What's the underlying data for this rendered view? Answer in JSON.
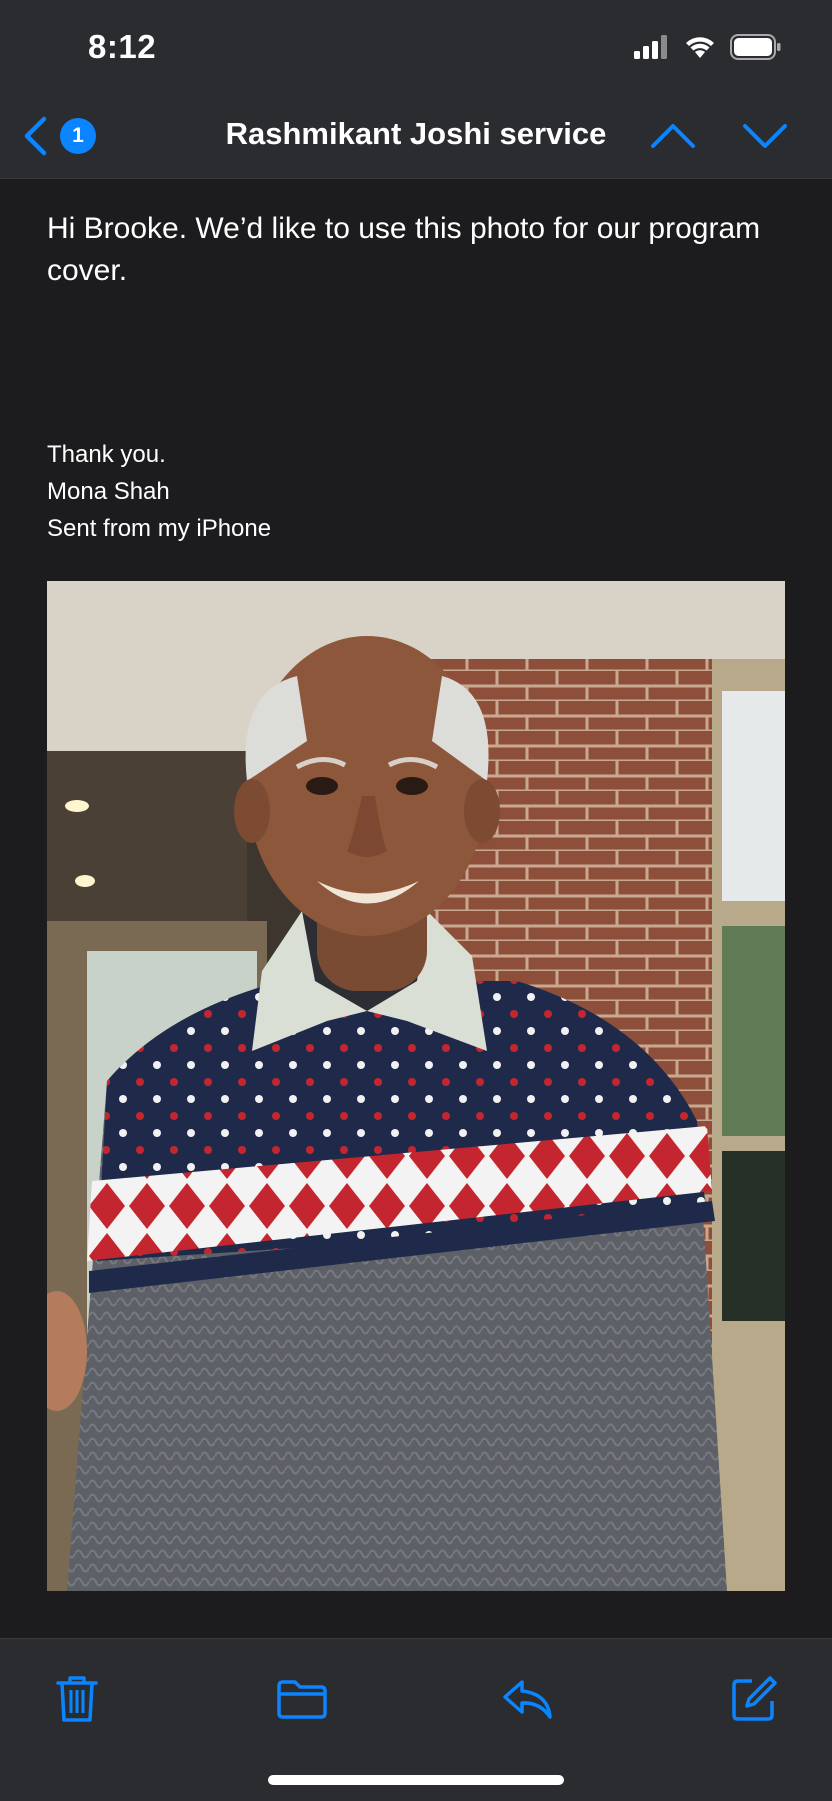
{
  "status": {
    "time": "8:12"
  },
  "nav": {
    "back_icon": "chevron-left-icon",
    "unread_count": "1",
    "title": "Rashmikant Joshi service",
    "prev_icon": "chevron-up-icon",
    "next_icon": "chevron-down-icon"
  },
  "message": {
    "body": "Hi Brooke. We’d like to use this photo for our program cover.",
    "signature": [
      "Thank you.",
      "Mona Shah",
      "Sent from my iPhone"
    ],
    "attachment": "photo of a smiling elderly man in a navy, red and white patterned sweater in front of a brick wall"
  },
  "toolbar": {
    "items": [
      "trash-icon",
      "folder-icon",
      "reply-icon",
      "compose-icon"
    ]
  },
  "colors": {
    "accent": "#0a84ff",
    "background": "#1c1c1e",
    "bars": "#2a2c2f"
  }
}
